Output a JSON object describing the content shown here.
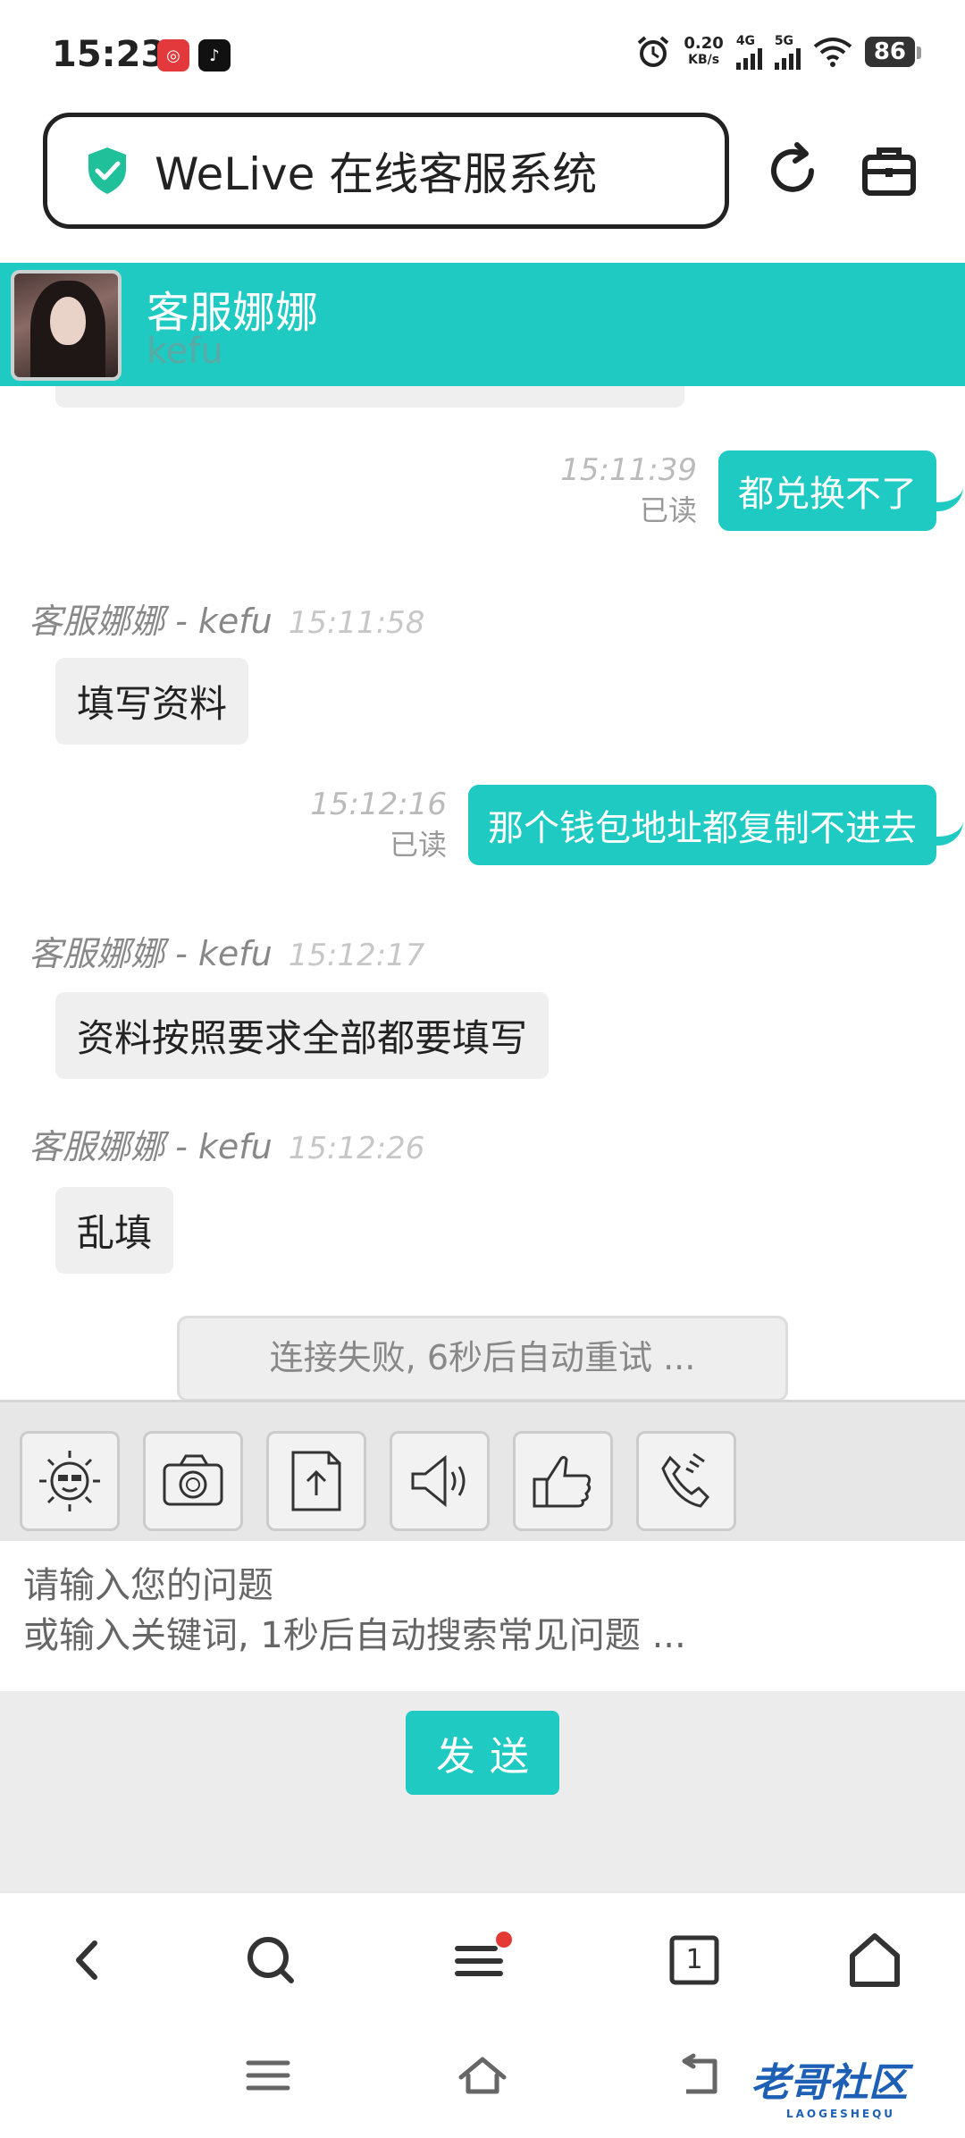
{
  "status_bar": {
    "time": "15:23",
    "net_speed_value": "0.20",
    "net_speed_unit": "KB/s",
    "sim1": "4G",
    "sim2": "5G",
    "battery": "86",
    "icons": [
      "pinduoduo-icon",
      "tiktok-icon",
      "alarm-icon",
      "wifi-icon"
    ]
  },
  "address_bar": {
    "title": "WeLive 在线客服系统",
    "icons": [
      "shield-check-icon",
      "reload-icon",
      "toolbox-icon"
    ]
  },
  "chat_header": {
    "agent_name": "客服娜娜",
    "agent_id": "kefu"
  },
  "messages": [
    {
      "side": "out",
      "time": "15:11:39",
      "status": "已读",
      "text": "都兑换不了"
    },
    {
      "side": "in",
      "sender": "客服娜娜 - kefu",
      "time": "15:11:58",
      "text": "填写资料"
    },
    {
      "side": "out",
      "time": "15:12:16",
      "status": "已读",
      "text": "那个钱包地址都复制不进去"
    },
    {
      "side": "in",
      "sender": "客服娜娜 - kefu",
      "time": "15:12:17",
      "text": "资料按照要求全部都要填写"
    },
    {
      "side": "in",
      "sender": "客服娜娜 - kefu",
      "time": "15:12:26",
      "text": "乱填"
    }
  ],
  "connection_notice": "连接失败, 6秒后自动重试 ...",
  "toolbar": [
    "emoji-icon",
    "camera-icon",
    "upload-icon",
    "sound-icon",
    "thumbs-up-icon",
    "phone-icon"
  ],
  "input": {
    "placeholder": "请输入您的问题\n或输入关键词, 1秒后自动搜索常见问题 ..."
  },
  "send_label": "发送",
  "browser_nav": {
    "tab_count": "1",
    "icons": [
      "back-icon",
      "search-icon",
      "menu-icon",
      "tabs-icon",
      "home-icon"
    ]
  },
  "watermark": {
    "text": "老哥社区",
    "sub": "LAOGESHEQU"
  },
  "colors": {
    "accent": "#1fcac2",
    "bubble_in": "#efefef",
    "toolbar_bg": "#e7e7e7"
  }
}
